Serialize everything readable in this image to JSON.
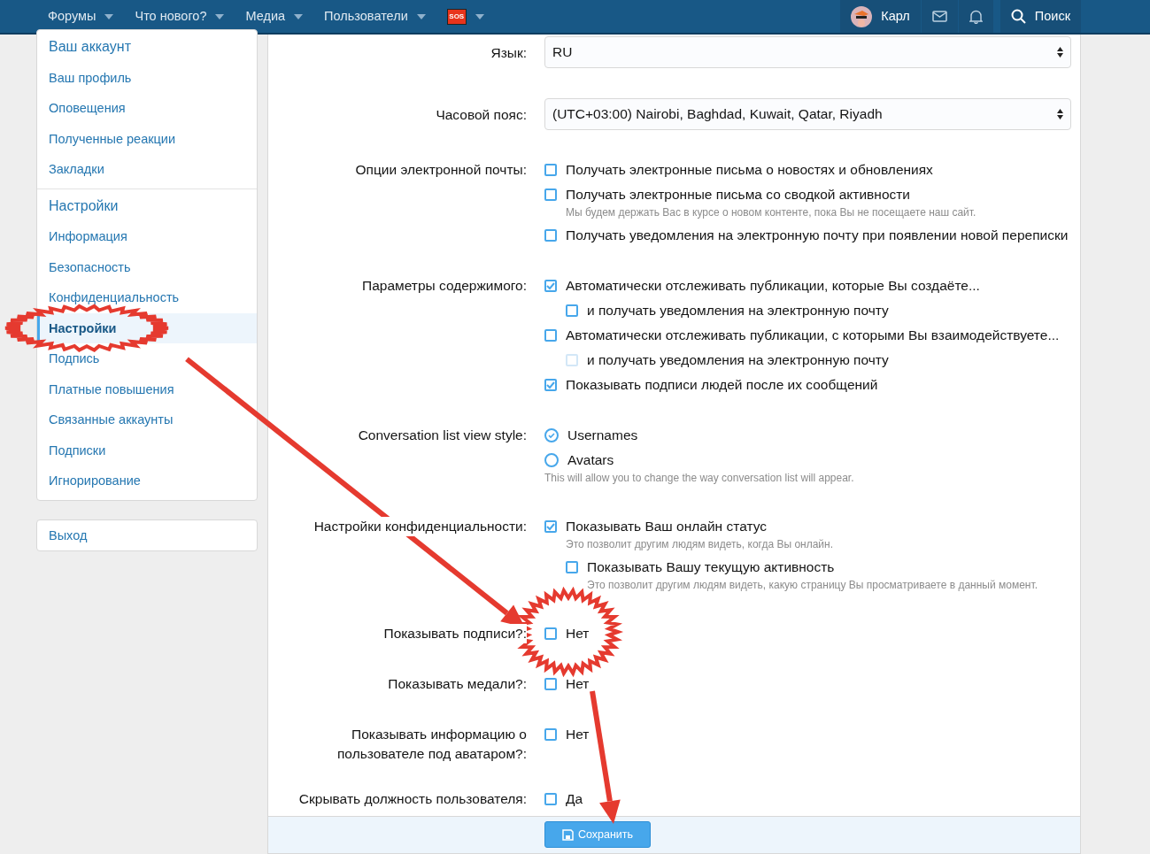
{
  "navbar": {
    "items": [
      {
        "label": "Форумы",
        "kind": "text"
      },
      {
        "label": "Что нового?",
        "kind": "text"
      },
      {
        "label": "Медиа",
        "kind": "text"
      },
      {
        "label": "Пользователи",
        "kind": "text"
      },
      {
        "label": "SOS",
        "kind": "badge"
      }
    ],
    "user": "Карл",
    "search": "Поиск"
  },
  "sidebar": {
    "groups": [
      {
        "items": [
          {
            "label": "Ваш аккаунт",
            "kind": "heading",
            "selected": false
          },
          {
            "label": "Ваш профиль",
            "kind": "link",
            "selected": false
          },
          {
            "label": "Оповещения",
            "kind": "link",
            "selected": false
          },
          {
            "label": "Полученные реакции",
            "kind": "link",
            "selected": false
          },
          {
            "label": "Закладки",
            "kind": "link",
            "selected": false
          }
        ]
      },
      {
        "items": [
          {
            "label": "Настройки",
            "kind": "heading",
            "selected": false
          },
          {
            "label": "Информация",
            "kind": "link",
            "selected": false
          },
          {
            "label": "Безопасность",
            "kind": "link",
            "selected": false
          },
          {
            "label": "Конфиденциальность",
            "kind": "link",
            "selected": false
          },
          {
            "label": "Настройки",
            "kind": "link",
            "selected": true
          },
          {
            "label": "Подпись",
            "kind": "link",
            "selected": false
          },
          {
            "label": "Платные повышения",
            "kind": "link",
            "selected": false
          },
          {
            "label": "Связанные аккаунты",
            "kind": "link",
            "selected": false
          },
          {
            "label": "Подписки",
            "kind": "link",
            "selected": false
          },
          {
            "label": "Игнорирование",
            "kind": "link",
            "selected": false
          }
        ]
      }
    ],
    "logout": "Выход"
  },
  "form": {
    "rows": [
      {
        "label": "Язык:",
        "kind": "select",
        "value": "RU"
      },
      {
        "label": "Часовой пояс:",
        "kind": "select",
        "value": "(UTC+03:00) Nairobi, Baghdad, Kuwait, Qatar, Riyadh"
      },
      {
        "label": "Опции электронной почты:",
        "kind": "options",
        "options": [
          {
            "kind": "checkbox",
            "label": "Получать электронные письма о новостях и обновлениях",
            "checked": false,
            "disabled": false
          },
          {
            "kind": "checkbox",
            "label": "Получать электронные письма со сводкой активности",
            "checked": false,
            "disabled": false,
            "hint": "Мы будем держать Вас в курсе о новом контенте, пока Вы не посещаете наш сайт."
          },
          {
            "kind": "checkbox",
            "label": "Получать уведомления на электронную почту при появлении новой переписки",
            "checked": false,
            "disabled": false
          }
        ]
      },
      {
        "label": "Параметры содержимого:",
        "kind": "options",
        "options": [
          {
            "kind": "checkbox",
            "label": "Автоматически отслеживать публикации, которые Вы создаёте...",
            "checked": true,
            "disabled": false,
            "children": [
              {
                "kind": "checkbox",
                "label": "и получать уведомления на электронную почту",
                "checked": false,
                "disabled": false
              }
            ]
          },
          {
            "kind": "checkbox",
            "label": "Автоматически отслеживать публикации, с которыми Вы взаимодействуете...",
            "checked": false,
            "disabled": false,
            "children": [
              {
                "kind": "checkbox",
                "label": "и получать уведомления на электронную почту",
                "checked": false,
                "disabled": true
              }
            ]
          },
          {
            "kind": "checkbox",
            "label": "Показывать подписи людей после их сообщений",
            "checked": true,
            "disabled": false
          }
        ]
      },
      {
        "label": "Conversation list view style:",
        "kind": "options",
        "hint": "This will allow you to change the way conversation list will appear.",
        "options": [
          {
            "kind": "radio",
            "label": "Usernames",
            "checked": true,
            "disabled": false
          },
          {
            "kind": "radio",
            "label": "Avatars",
            "checked": false,
            "disabled": false
          }
        ]
      },
      {
        "label": "Настройки конфиденциальности:",
        "kind": "options",
        "options": [
          {
            "kind": "checkbox",
            "label": "Показывать Ваш онлайн статус",
            "checked": true,
            "disabled": false,
            "hint": "Это позволит другим людям видеть, когда Вы онлайн.",
            "children": [
              {
                "kind": "checkbox",
                "label": "Показывать Вашу текущую активность",
                "checked": false,
                "disabled": false,
                "hint": "Это позволит другим людям видеть, какую страницу Вы просматриваете в данный момент."
              }
            ]
          }
        ]
      },
      {
        "label": "Показывать подписи?:",
        "kind": "options",
        "options": [
          {
            "kind": "checkbox",
            "label": "Нет",
            "checked": false,
            "disabled": false
          }
        ]
      },
      {
        "label": "Показывать медали?:",
        "kind": "options",
        "options": [
          {
            "kind": "checkbox",
            "label": "Нет",
            "checked": false,
            "disabled": false
          }
        ]
      },
      {
        "label": "Показывать информацию о пользователе под аватаром?:",
        "kind": "options",
        "options": [
          {
            "kind": "checkbox",
            "label": "Нет",
            "checked": false,
            "disabled": false
          }
        ]
      },
      {
        "label": "Скрывать должность пользователя:",
        "kind": "options",
        "options": [
          {
            "kind": "checkbox",
            "label": "Да",
            "checked": false,
            "disabled": false
          }
        ]
      }
    ],
    "submit": "Сохранить"
  },
  "annotations": [
    {
      "kind": "starburst"
    },
    {
      "kind": "starburst"
    },
    {
      "kind": "arrow"
    },
    {
      "kind": "arrow"
    }
  ]
}
